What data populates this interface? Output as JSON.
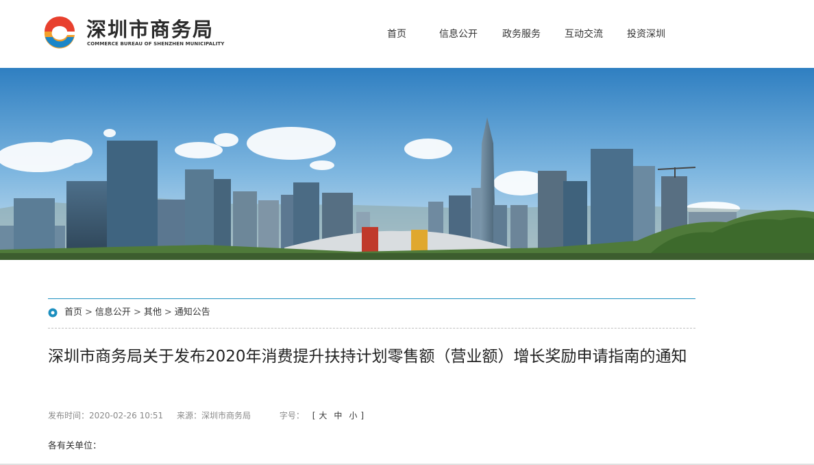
{
  "header": {
    "logo_cn": "深圳市商务局",
    "logo_en": "COMMERCE BUREAU OF SHENZHEN MUNICIPALITY",
    "nav": [
      "首页",
      "信息公开",
      "政务服务",
      "互动交流",
      "投资深圳"
    ]
  },
  "breadcrumb": {
    "items": [
      "首页",
      "信息公开",
      "其他",
      "通知公告"
    ],
    "separator": ">"
  },
  "article": {
    "title": "深圳市商务局关于发布2020年消费提升扶持计划零售额（营业额）增长奖励申请指南的通知",
    "publish_label": "发布时间：",
    "publish_time": "2020-02-26 10:51",
    "source_label": "来源：",
    "source": "深圳市商务局",
    "font_label": "字号：",
    "bracket_open": "[",
    "font_sizes": [
      "大",
      "中",
      "小"
    ],
    "bracket_close": "]",
    "greeting": "各有关单位："
  },
  "colors": {
    "accent": "#1d8fbf",
    "logo_red": "#e8402e",
    "logo_orange": "#f39b1f",
    "logo_blue": "#1b86c8"
  },
  "icons": {
    "breadcrumb": "location-dot-icon"
  }
}
